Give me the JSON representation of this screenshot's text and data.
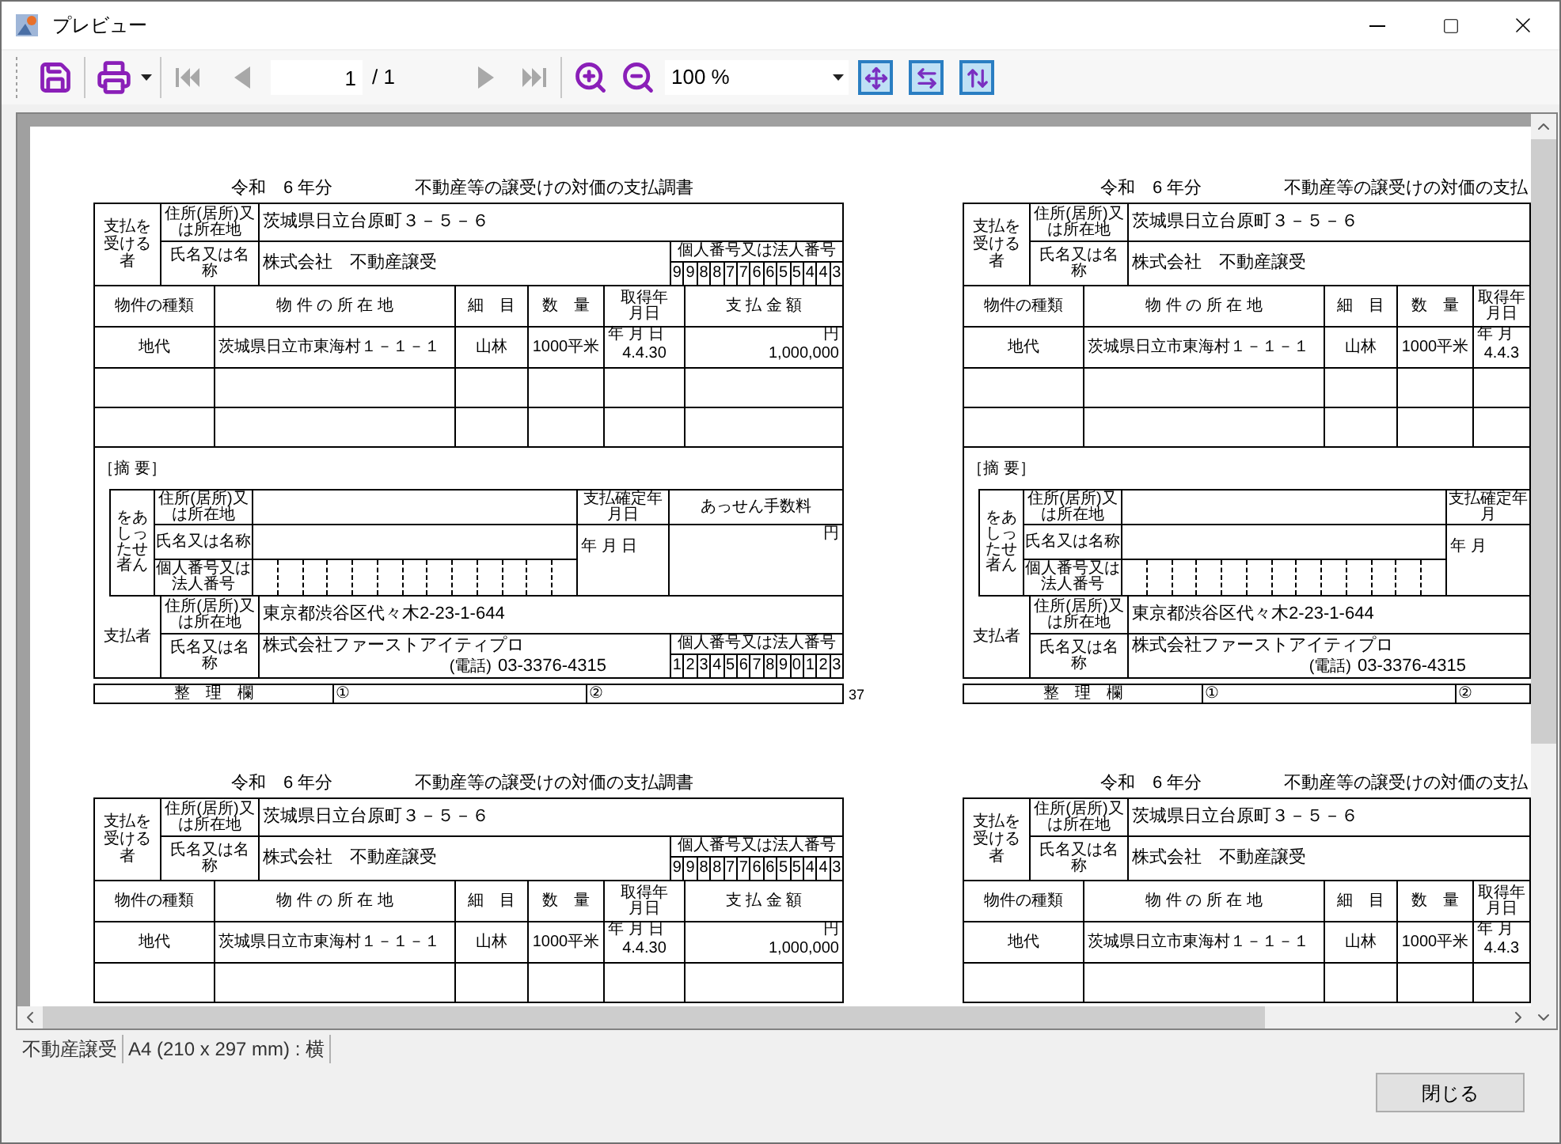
{
  "window": {
    "title": "プレビュー"
  },
  "toolbar": {
    "first_page": {
      "disabled": true
    },
    "previous_page": {
      "disabled": true
    },
    "page": "1",
    "page_total": "/ 1",
    "next_page": {
      "disabled": true
    },
    "last_page": {
      "disabled": true
    },
    "zoom": "100 %"
  },
  "forms": [
    {
      "era_year": "令和　6 年分",
      "title": "不動産等の譲受けの対価の支払調書",
      "payee": {
        "label": "支払を受ける者",
        "address_label": "住所(居所)又は所在地",
        "address": "茨城県日立台原町３－５－６",
        "name_label": "氏名又は名称",
        "name": "株式会社　不動産譲受",
        "number_label": "個人番号又は法人番号",
        "number": [
          "9",
          "9",
          "8",
          "8",
          "7",
          "7",
          "6",
          "6",
          "5",
          "5",
          "4",
          "4",
          "3"
        ]
      },
      "columns": [
        "物件の種類",
        "物 件 の 所 在 地",
        "細　目",
        "数　量",
        "取得年月日",
        "支 払 金 額"
      ],
      "date_units": "年 月 日",
      "amount_unit": "円",
      "rows": [
        {
          "cells": [
            "地代",
            "茨城県日立市東海村１－１－１",
            "山林",
            "1000平米",
            "4.4.30",
            "1,000,000"
          ]
        }
      ],
      "remarks": {
        "label": "［摘 要］"
      },
      "broker": {
        "label": "あっせんをした者",
        "address_label": "住所(居所)又は所在地",
        "name_label": "氏名又は名称",
        "number_label": "個人番号又は法人番号",
        "date_label": "支払確定年月日",
        "date_units": "年 月 日",
        "fee_label": "あっせん手数料",
        "fee_unit": "円"
      },
      "payer": {
        "label": "支払者",
        "address_label": "住所(居所)又は所在地",
        "address": "東京都渋谷区代々木2-23-1-644",
        "name_label": "氏名又は名称",
        "name": "株式会社ファーストアイティプロ",
        "phone_label": "(電話)",
        "phone": "03-3376-4315",
        "number_label": "個人番号又は法人番号",
        "number": [
          "1",
          "2",
          "3",
          "4",
          "5",
          "6",
          "7",
          "8",
          "9",
          "0",
          "1",
          "2",
          "3"
        ]
      },
      "footer": {
        "label": "整　理　欄",
        "field_1": "①",
        "field_2": "②"
      },
      "page_mark": "37"
    },
    {
      "era_year": "令和　6 年分",
      "title": "不動産等の譲受けの対価の支払",
      "payee": {
        "label": "支払を受ける者",
        "address_label": "住所(居所)又は所在地",
        "address": "茨城県日立台原町３－５－６",
        "name_label": "氏名又は名称",
        "name": "株式会社　不動産譲受"
      },
      "columns": [
        "物件の種類",
        "物 件 の 所 在 地",
        "細　目",
        "数　量",
        "取得年月日"
      ],
      "date_units": "年 月",
      "rows": [
        {
          "cells": [
            "地代",
            "茨城県日立市東海村１－１－１",
            "山林",
            "1000平米",
            "4.4.3"
          ]
        }
      ],
      "remarks": {
        "label": "［摘 要］"
      },
      "broker": {
        "label": "あっせんをした者",
        "address_label": "住所(居所)又は所在地",
        "name_label": "氏名又は名称",
        "number_label": "個人番号又は法人番号",
        "date_label": "支払確定年月",
        "date_units": "年 月"
      },
      "payer": {
        "label": "支払者",
        "address_label": "住所(居所)又は所在地",
        "address": "東京都渋谷区代々木2-23-1-644",
        "name_label": "氏名又は名称",
        "name": "株式会社ファーストアイティプロ",
        "phone_label": "(電話)",
        "phone": "03-3376-4315"
      },
      "footer": {
        "label": "整　理　欄",
        "field_1": "①",
        "field_2": "②"
      }
    },
    {
      "era_year": "令和　6 年分",
      "title": "不動産等の譲受けの対価の支払調書",
      "payee": {
        "label": "支払を受ける者",
        "address_label": "住所(居所)又は所在地",
        "address": "茨城県日立台原町３－５－６",
        "name_label": "氏名又は名称",
        "name": "株式会社　不動産譲受",
        "number_label": "個人番号又は法人番号",
        "number": [
          "9",
          "9",
          "8",
          "8",
          "7",
          "7",
          "6",
          "6",
          "5",
          "5",
          "4",
          "4",
          "3"
        ]
      },
      "columns": [
        "物件の種類",
        "物 件 の 所 在 地",
        "細　目",
        "数　量",
        "取得年月日",
        "支 払 金 額"
      ],
      "date_units": "年 月 日",
      "amount_unit": "円",
      "rows": [
        {
          "cells": [
            "地代",
            "茨城県日立市東海村１－１－１",
            "山林",
            "1000平米",
            "4.4.30",
            "1,000,000"
          ]
        }
      ]
    },
    {
      "era_year": "令和　6 年分",
      "title": "不動産等の譲受けの対価の支払",
      "payee": {
        "label": "支払を受ける者",
        "address_label": "住所(居所)又は所在地",
        "address": "茨城県日立台原町３－５－６",
        "name_label": "氏名又は名称",
        "name": "株式会社　不動産譲受"
      },
      "columns": [
        "物件の種類",
        "物 件 の 所 在 地",
        "細　目",
        "数　量",
        "取得年月日"
      ],
      "date_units": "年 月",
      "rows": [
        {
          "cells": [
            "地代",
            "茨城県日立市東海村１－１－１",
            "山林",
            "1000平米",
            "4.4.3"
          ]
        }
      ]
    }
  ],
  "status_bar": [
    "不動産譲受",
    "A4 (210 x 297 mm) : 横"
  ],
  "close_button": "閉じる"
}
